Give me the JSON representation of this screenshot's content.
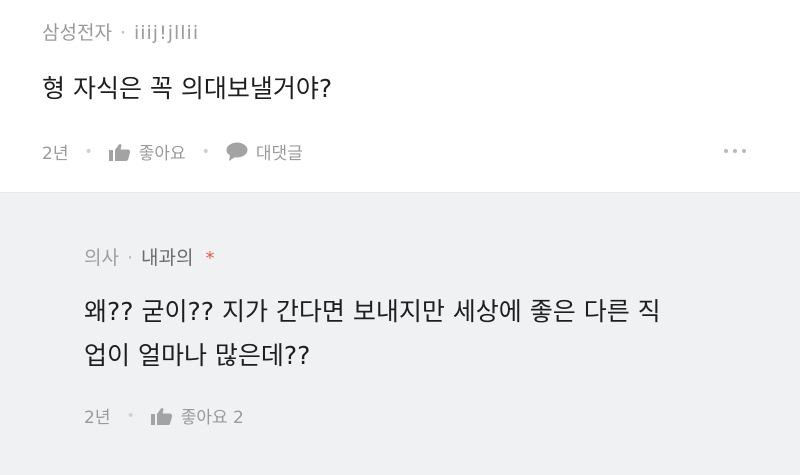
{
  "comment": {
    "author_company": "삼성전자",
    "separator": "·",
    "author_nick": "iiij!jllii",
    "text": "형 자식은 꼭 의대보낼거야?",
    "time": "2년",
    "like_label": "좋아요",
    "reply_label": "대댓글",
    "icons": {
      "like": "thumbs-up-icon",
      "reply": "speech-bubble-icon",
      "more": "more-dots-icon"
    }
  },
  "reply": {
    "author_job": "의사",
    "separator": "·",
    "author_dept": "내과의",
    "author_mark": "*",
    "line1": "왜?? 굳이?? 지가 간다면 보내지만 세상에 좋은 다른 직",
    "line2": "업이 얼마나 많은데??",
    "time": "2년",
    "like_label": "좋아요 2",
    "colors": {
      "author_mark": "#e05a4a",
      "background": "#f0f1f3"
    }
  }
}
